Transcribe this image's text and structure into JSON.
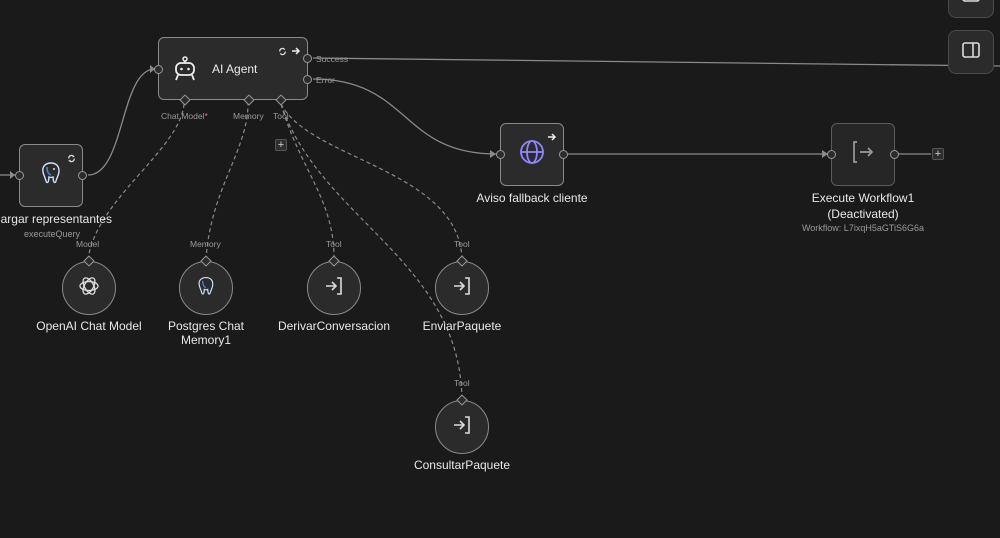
{
  "nodes": {
    "cargar": {
      "title": "Cargar representantes",
      "subtitle": "executeQuery"
    },
    "agent": {
      "title": "AI Agent",
      "outputs": {
        "success": "Success",
        "error": "Error"
      },
      "inputs": {
        "chat_model": "Chat Model",
        "required_mark": "*",
        "memory": "Memory",
        "tool": "Tool"
      }
    },
    "aviso": {
      "title": "Aviso fallback cliente"
    },
    "execute": {
      "title_line1": "Execute Workflow1",
      "title_line2": "(Deactivated)",
      "subtitle": "Workflow: L7ixqH5aGTiS6G6a"
    },
    "openai": {
      "title": "OpenAI Chat Model",
      "port": "Model"
    },
    "postgres_memory": {
      "title_line1": "Postgres Chat",
      "title_line2": "Memory1",
      "port": "Memory"
    },
    "derivar": {
      "title": "DerivarConversacion",
      "port": "Tool"
    },
    "enviar": {
      "title": "EnviarPaquete",
      "port": "Tool"
    },
    "consultar": {
      "title": "ConsultarPaquete",
      "port": "Tool"
    }
  },
  "icons": {
    "postgres": "elephant-icon",
    "agent": "robot-icon",
    "http": "globe-icon",
    "execute": "bracket-arrow-icon",
    "openai": "openai-icon",
    "tool": "enter-icon"
  },
  "colors": {
    "canvas": "#1a1a1a",
    "node": "#2b2b2b",
    "http_icon": "#8f86ff",
    "postgres_icon": "#4a7fd0"
  },
  "add_symbol": "+"
}
